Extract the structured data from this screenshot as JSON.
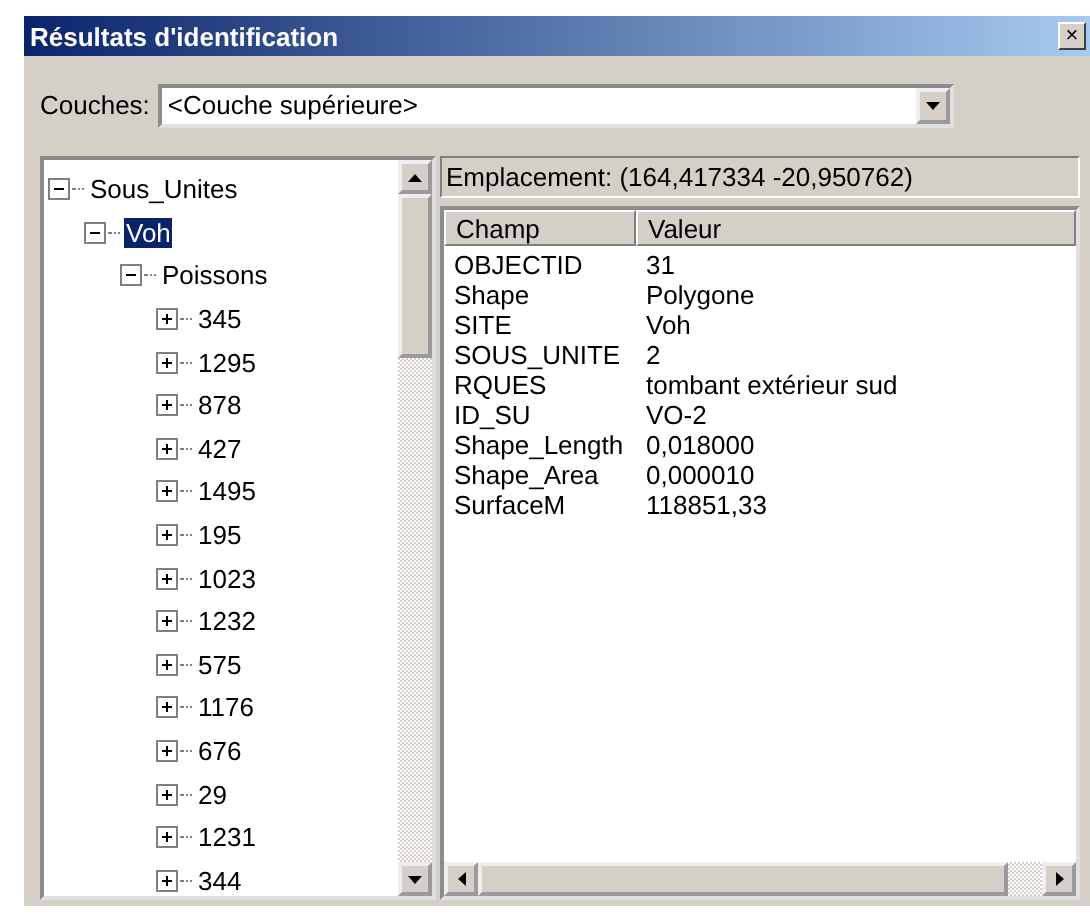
{
  "window": {
    "title": "Résultats d'identification",
    "close": "×"
  },
  "layer": {
    "label": "Couches:",
    "value": "<Couche supérieure>"
  },
  "tree": [
    {
      "label": "Sous_Unites",
      "expanded": true,
      "selected": false,
      "children": [
        {
          "label": "Voh",
          "expanded": true,
          "selected": true,
          "children": [
            {
              "label": "Poissons",
              "expanded": true,
              "selected": false,
              "children": [
                {
                  "label": "345",
                  "expanded": false,
                  "selected": false
                },
                {
                  "label": "1295",
                  "expanded": false,
                  "selected": false
                },
                {
                  "label": "878",
                  "expanded": false,
                  "selected": false
                },
                {
                  "label": "427",
                  "expanded": false,
                  "selected": false
                },
                {
                  "label": "1495",
                  "expanded": false,
                  "selected": false
                },
                {
                  "label": "195",
                  "expanded": false,
                  "selected": false
                },
                {
                  "label": "1023",
                  "expanded": false,
                  "selected": false
                },
                {
                  "label": "1232",
                  "expanded": false,
                  "selected": false
                },
                {
                  "label": "575",
                  "expanded": false,
                  "selected": false
                },
                {
                  "label": "1176",
                  "expanded": false,
                  "selected": false
                },
                {
                  "label": "676",
                  "expanded": false,
                  "selected": false
                },
                {
                  "label": "29",
                  "expanded": false,
                  "selected": false
                },
                {
                  "label": "1231",
                  "expanded": false,
                  "selected": false
                },
                {
                  "label": "344",
                  "expanded": false,
                  "selected": false
                }
              ]
            }
          ]
        }
      ]
    }
  ],
  "location": "Emplacement: (164,417334 -20,950762)",
  "table": {
    "columns": [
      "Champ",
      "Valeur"
    ],
    "rows": [
      [
        "OBJECTID",
        "31"
      ],
      [
        "Shape",
        "Polygone"
      ],
      [
        "SITE",
        "Voh"
      ],
      [
        "SOUS_UNITE",
        "2"
      ],
      [
        "RQUES",
        "tombant extérieur sud"
      ],
      [
        "ID_SU",
        "VO-2"
      ],
      [
        "Shape_Length",
        "0,018000"
      ],
      [
        "Shape_Area",
        "0,000010"
      ],
      [
        "SurfaceM",
        "118851,33"
      ]
    ]
  }
}
